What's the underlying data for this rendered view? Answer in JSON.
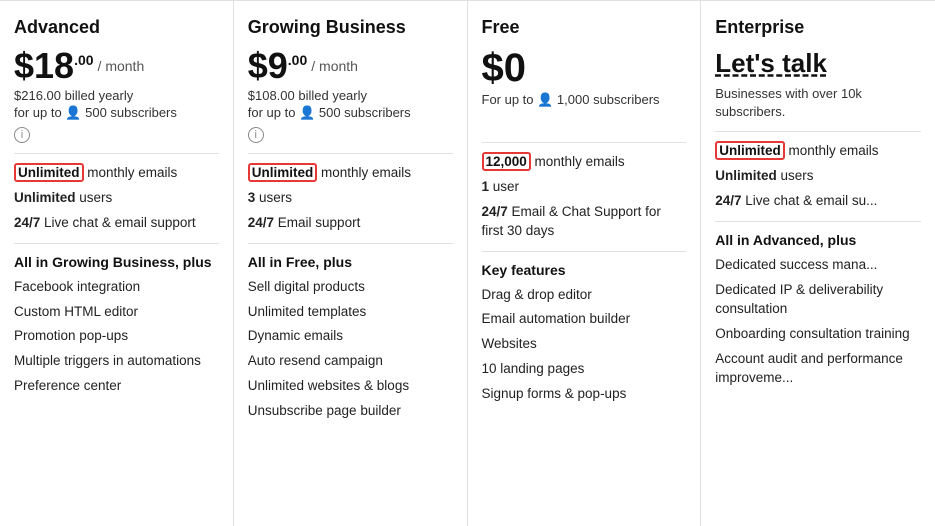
{
  "plans": [
    {
      "id": "advanced",
      "name": "Advanced",
      "price_symbol": "$",
      "price_main": "18",
      "price_sup": ".00",
      "price_period": "/ month",
      "billed": "$216.00 billed yearly",
      "subscribers": "for up to 👤 500 subscribers",
      "highlight_label": "Unlimited",
      "highlight_suffix": " monthly emails",
      "features_basic": [
        {
          "bold": "Unlimited",
          "rest": " users"
        },
        {
          "bold": "24/7",
          "rest": " Live chat & email support"
        }
      ],
      "section_title": "All in Growing Business, plus",
      "features_extra": [
        "Facebook integration",
        "Custom HTML editor",
        "Promotion pop-ups",
        "Multiple triggers in automations",
        "Preference center"
      ]
    },
    {
      "id": "growing",
      "name": "Growing Business",
      "price_symbol": "$",
      "price_main": "9",
      "price_sup": ".00",
      "price_period": "/ month",
      "billed": "$108.00 billed yearly",
      "subscribers": "for up to 👤 500 subscribers",
      "highlight_label": "Unlimited",
      "highlight_suffix": " monthly emails",
      "features_basic": [
        {
          "bold": "3",
          "rest": " users"
        },
        {
          "bold": "24/7",
          "rest": " Email support"
        }
      ],
      "section_title": "All in Free, plus",
      "features_extra": [
        "Sell digital products",
        "Unlimited templates",
        "Dynamic emails",
        "Auto resend campaign",
        "Unlimited websites & blogs",
        "Unsubscribe page builder"
      ]
    },
    {
      "id": "free",
      "name": "Free",
      "price_symbol": "$",
      "price_main": "0",
      "price_sup": "",
      "price_period": "",
      "billed": "For up to 👤 1,000 subscribers",
      "subscribers": "",
      "highlight_label": "12,000",
      "highlight_suffix": " monthly emails",
      "features_basic": [
        {
          "bold": "1",
          "rest": " user"
        },
        {
          "bold": "24/7",
          "rest": " Email & Chat Support for first 30 days"
        }
      ],
      "section_title": "Key features",
      "features_extra": [
        "Drag & drop editor",
        "Email automation builder",
        "Websites",
        "10 landing pages",
        "Signup forms & pop-ups"
      ]
    },
    {
      "id": "enterprise",
      "name": "Enterprise",
      "lets_talk": "Let's talk",
      "desc": "Businesses with over 10k subscribers.",
      "highlight_label": "Unlimited",
      "highlight_suffix": " monthly emails",
      "features_basic": [
        {
          "bold": "Unlimited",
          "rest": " users"
        },
        {
          "bold": "24/7",
          "rest": " Live chat & email su..."
        }
      ],
      "section_title": "All in Advanced, plus",
      "features_extra": [
        "Dedicated success mana...",
        "Dedicated IP & deliverability consultation",
        "Onboarding consultation training",
        "Account audit and performance improveme..."
      ]
    }
  ]
}
